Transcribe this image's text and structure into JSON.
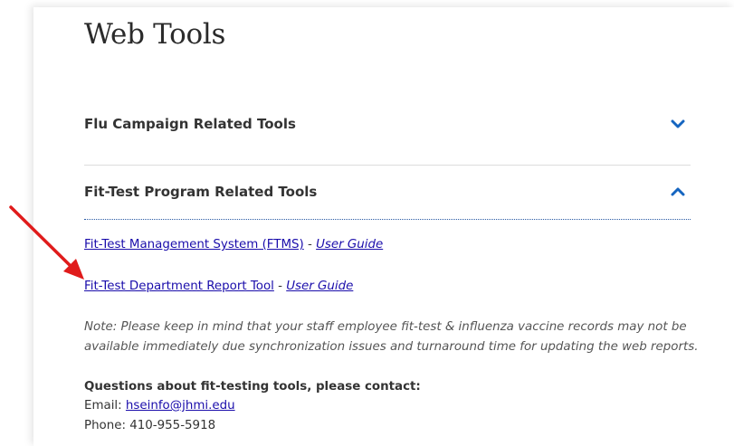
{
  "page": {
    "title": "Web Tools"
  },
  "accordions": [
    {
      "title": "Flu Campaign Related Tools",
      "state": "collapsed",
      "icon": "chevron-down-icon"
    },
    {
      "title": "Fit-Test Program Related Tools",
      "state": "expanded",
      "icon": "chevron-up-icon"
    }
  ],
  "fit_test": {
    "links": [
      {
        "label": "Fit-Test Management System (FTMS)",
        "separator": " - ",
        "guide": "User Guide"
      },
      {
        "label": "Fit-Test Department Report Tool",
        "separator": " - ",
        "guide": "User Guide"
      }
    ],
    "note": "Note: Please keep in mind that your staff employee fit-test & influenza vaccine records may not be available immediately due synchronization issues and turnaround time for updating the web reports.",
    "contact": {
      "heading": "Questions about fit-testing tools, please contact:",
      "email_label": "Email: ",
      "email": "hseinfo@jhmi.edu",
      "phone_label": "Phone: ",
      "phone": "410-955-5918"
    }
  },
  "colors": {
    "accent": "#1565c0",
    "link": "#1a0dab",
    "annotation_arrow": "#e01b1b"
  }
}
